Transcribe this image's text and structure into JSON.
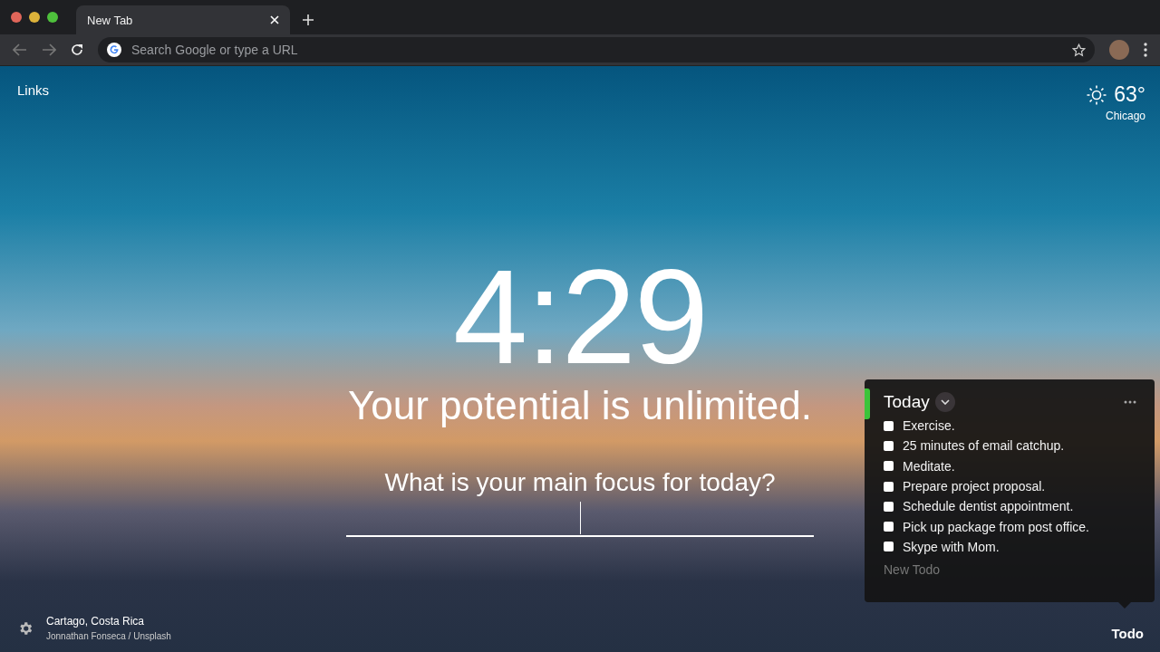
{
  "browser": {
    "tab": {
      "title": "New Tab",
      "selected": true
    },
    "address_bar": {
      "placeholder": "Search Google or type a URL"
    }
  },
  "links": "Links",
  "weather": {
    "temperature": "63°",
    "location": "Chicago"
  },
  "clock": "4:29",
  "mantra": "Your potential is unlimited.",
  "focus": {
    "question": "What is your main focus for today?"
  },
  "todo_panel": {
    "list_title": "Today",
    "todos": [
      {
        "text": "Exercise.",
        "checked": false
      },
      {
        "text": "25 minutes of email catchup.",
        "checked": false
      },
      {
        "text": "Meditate.",
        "checked": false
      },
      {
        "text": "Prepare project proposal.",
        "checked": false
      },
      {
        "text": "Schedule dentist appointment.",
        "checked": false
      },
      {
        "text": "Pick up package from post office.",
        "checked": false
      },
      {
        "text": "Skype with Mom.",
        "checked": false
      }
    ],
    "new_todo": {
      "placeholder": "New Todo"
    }
  },
  "photo_info": {
    "location": "Cartago, Costa Rica",
    "credit": "Jonnathan Fonseca / Unsplash"
  },
  "todo_button": "Todo"
}
